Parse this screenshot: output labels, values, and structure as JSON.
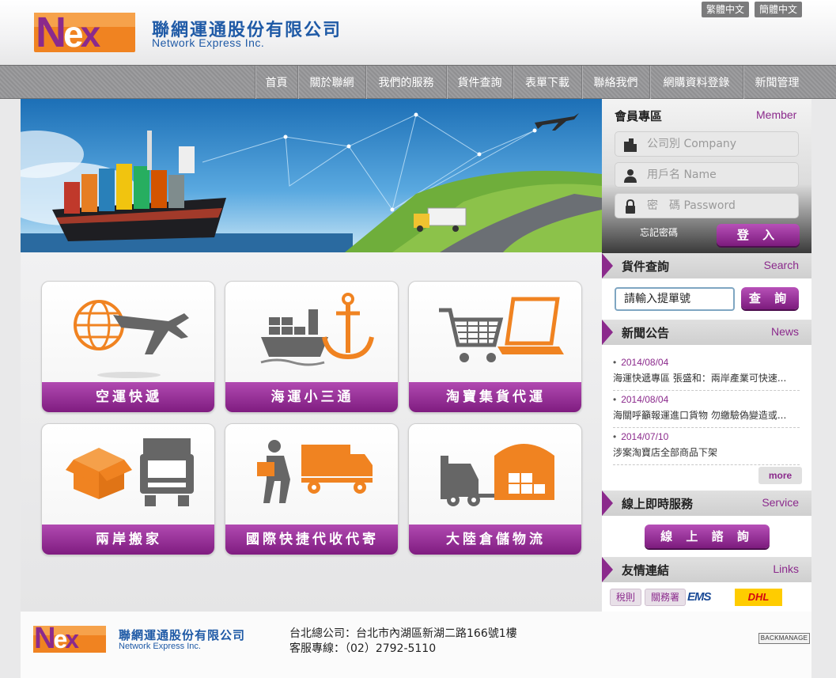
{
  "header": {
    "logo_text": "Nex",
    "company_cn": "聯網運通股份有限公司",
    "company_en": "Network Express Inc.",
    "lang_buttons": [
      "繁體中文",
      "簡體中文"
    ]
  },
  "nav": {
    "items": [
      "首頁",
      "關於聯網",
      "我們的服務",
      "貨件查詢",
      "表單下載",
      "聯絡我們",
      "網購資料登錄",
      "新聞管理"
    ]
  },
  "services": [
    {
      "label": "空運快遞",
      "icon": "air-freight-icon"
    },
    {
      "label": "海運小三通",
      "icon": "sea-freight-icon"
    },
    {
      "label": "淘寶集貨代運",
      "icon": "taobao-shopping-icon"
    },
    {
      "label": "兩岸搬家",
      "icon": "moving-box-truck-icon"
    },
    {
      "label": "國際快捷代收代寄",
      "icon": "courier-delivery-icon"
    },
    {
      "label": "大陸倉儲物流",
      "icon": "warehouse-forklift-icon"
    }
  ],
  "member": {
    "title": "會員專區",
    "title_en": "Member",
    "company_placeholder": "公司別   Company",
    "user_placeholder": "用戶名   Name",
    "password_placeholder": "密　碼   Password",
    "forgot": "忘記密碼",
    "login": "登 入"
  },
  "search": {
    "title": "貨件查詢",
    "title_en": "Search",
    "input_value": "請輸入提單號",
    "button": "查 詢"
  },
  "news": {
    "title": "新聞公告",
    "title_en": "News",
    "items": [
      {
        "date": "2014/08/04",
        "title": "海運快遞專區 張盛和：兩岸產業可快速..."
      },
      {
        "date": "2014/08/04",
        "title": "海關呼籲報運進口貨物 勿繳驗偽變造或..."
      },
      {
        "date": "2014/07/10",
        "title": "涉案淘寶店全部商品下架"
      }
    ],
    "more": "more"
  },
  "service": {
    "title": "線上即時服務",
    "title_en": "Service",
    "button": "線 上 諮 詢"
  },
  "links": {
    "title": "友情連結",
    "title_en": "Links",
    "items": [
      "稅則",
      "關務署"
    ],
    "logos": [
      "EMS",
      "DHL"
    ]
  },
  "footer": {
    "logo_text": "Nex",
    "company_cn": "聯網運通股份有限公司",
    "company_en": "Network Express Inc.",
    "address": "台北總公司：台北市內湖區新湖二路166號1樓",
    "phone": "客服專線：（02）2792-5110",
    "backmanage": "BACKMANAGE"
  },
  "colors": {
    "brand_purple": "#8b2a8c",
    "brand_orange": "#f08321",
    "brand_blue": "#1f5aa6",
    "icon_orange": "#f08321",
    "icon_gray": "#666666"
  }
}
